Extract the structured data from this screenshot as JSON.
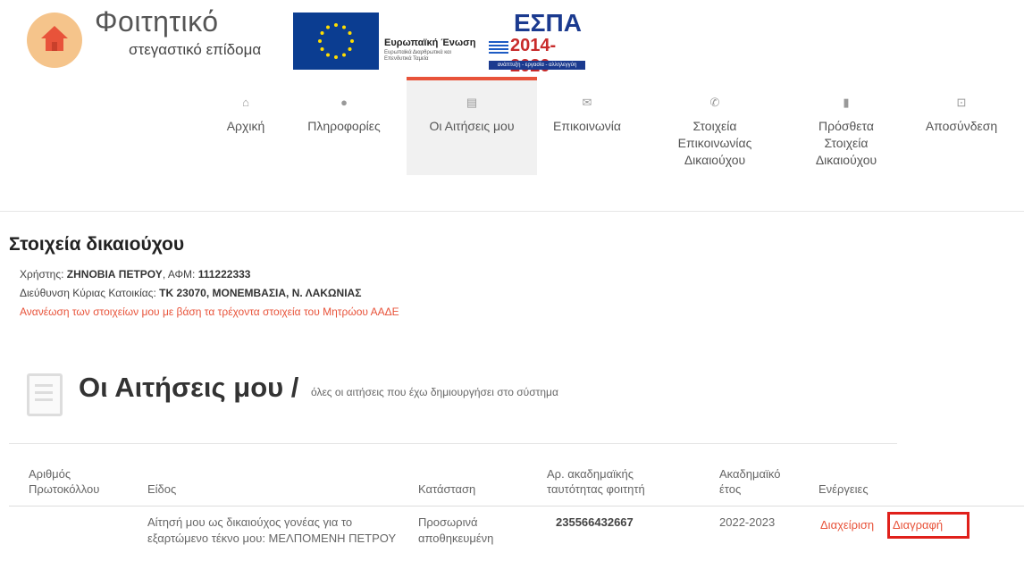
{
  "branding": {
    "title": "Φοιτητικό",
    "subtitle": "στεγαστικό επίδομα",
    "eu_label": "Ευρωπαϊκή Ένωση",
    "eu_fund": "Ευρωπαϊκά Διαρθρωτικά και Επενδυτικά Ταμεία",
    "espa_title": "ΕΣΠΑ",
    "espa_years": "2014-2020",
    "espa_slogan": "ανάπτυξη - εργασία - αλληλεγγύη"
  },
  "nav": {
    "items": [
      {
        "label": "Αρχική",
        "icon": "home-icon"
      },
      {
        "label": "Πληροφορίες",
        "icon": "info-icon"
      },
      {
        "label": "Οι Αιτήσεις μου",
        "icon": "file-icon"
      },
      {
        "label": "Επικοινωνία",
        "icon": "envelope-icon"
      },
      {
        "label": "Στοιχεία Επικοινωνίας Δικαιούχου",
        "icon": "phone-icon"
      },
      {
        "label": "Πρόσθετα Στοιχεία Δικαιούχου",
        "icon": "address-book-icon"
      },
      {
        "label": "Αποσύνδεση",
        "icon": "lock-icon"
      }
    ],
    "active": "Οι Αιτήσεις μου"
  },
  "beneficiary": {
    "heading": "Στοιχεία δικαιούχου",
    "user_label": "Χρήστης:",
    "user_name": "ΖΗΝΟΒΙΑ ΠΕΤΡΟΥ",
    "afm_label": "ΑΦΜ:",
    "afm": "111222333",
    "address_label": "Διεύθυνση Κύριας Κατοικίας:",
    "address": "ΤΚ 23070, ΜΟΝΕΜΒΑΣΙΑ, Ν. ΛΑΚΩΝΙΑΣ",
    "renew_link": "Ανανέωση των στοιχείων μου με βάση τα τρέχοντα στοιχεία του Μητρώου ΑΑΔΕ"
  },
  "applications": {
    "heading": "Οι Αιτήσεις μου /",
    "subheading": "όλες οι αιτήσεις που έχω δημιουργήσει στο σύστημα",
    "columns": [
      "Αριθμός Πρωτοκόλλου",
      "Είδος",
      "Κατάσταση",
      "Αρ. ακαδημαϊκής ταυτότητας φοιτητή",
      "Ακαδημαϊκό έτος",
      "Ενέργειες"
    ],
    "rows": [
      {
        "protocol": "",
        "type": "Αίτησή μου ως δικαιούχος γονέας για το εξαρτώμενο τέκνο μου: ΜΕΛΠΟΜΕΝΗ ΠΕΤΡΟΥ",
        "status": "Προσωρινά αποθηκευμένη",
        "student_id": "235566432667",
        "year": "2022-2023",
        "action_manage": "Διαχείριση",
        "action_delete": "Διαγραφή"
      }
    ]
  },
  "colors": {
    "accent": "#e8533a",
    "highlight": "#e0201b"
  }
}
